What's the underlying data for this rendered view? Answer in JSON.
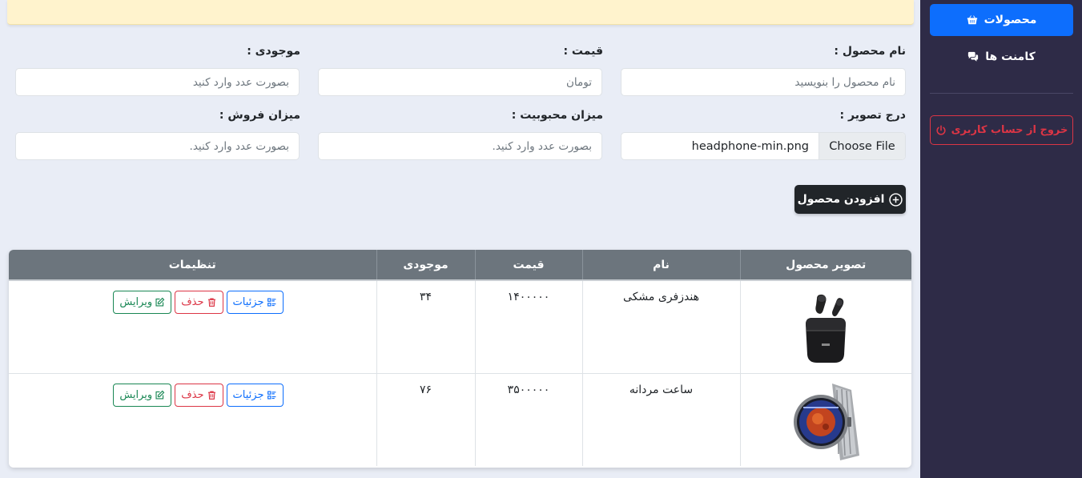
{
  "sidebar": {
    "products_label": "محصولات",
    "comments_label": "کامنت ها",
    "logout_label": "خروج از حساب کاربری"
  },
  "form": {
    "name_label": "نام محصول :",
    "name_placeholder": "نام محصول را بنویسید",
    "price_label": "قیمت :",
    "price_placeholder": "تومان",
    "stock_label": "موجودی :",
    "stock_placeholder": "بصورت عدد وارد کنید",
    "image_label": "درج تصویر :",
    "file_button": "Choose File",
    "file_name": "headphone-min.png",
    "popularity_label": "میزان محبوبیت :",
    "popularity_placeholder": "بصورت عدد وارد کنید.",
    "sales_label": "میزان فروش :",
    "sales_placeholder": "بصورت عدد وارد کنید.",
    "add_button": "افزودن محصول"
  },
  "table": {
    "headers": [
      "تصویر محصول",
      "نام",
      "قیمت",
      "موجودی",
      "تنظیمات"
    ],
    "rows": [
      {
        "image": "headphones",
        "name": "هندزفری مشکی",
        "price": "۱۴۰۰۰۰۰",
        "stock": "۳۴"
      },
      {
        "image": "smartwatch",
        "name": "ساعت مردانه",
        "price": "۳۵۰۰۰۰۰",
        "stock": "۷۶"
      }
    ],
    "actions": {
      "details": "جزئیات",
      "delete": "حذف",
      "edit": "ویرایش"
    }
  },
  "colors": {
    "sidebar_bg": "#2e2b47",
    "primary": "#0d6efd",
    "danger": "#dc3545",
    "success": "#198754",
    "header_bg": "#6c757d",
    "alert_bg": "#fff3cd"
  }
}
